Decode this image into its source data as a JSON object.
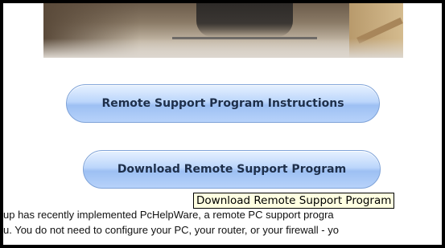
{
  "buttons": {
    "instructions_label": "Remote Support Program Instructions",
    "download_label": "Download Remote Support Program"
  },
  "tooltip": {
    "text": "Download Remote Support Program"
  },
  "body_text": {
    "line1": "up has recently implemented PcHelpWare, a remote PC support progra",
    "line2": "u.  You do not need to configure your PC, your router, or your firewall - yo"
  }
}
